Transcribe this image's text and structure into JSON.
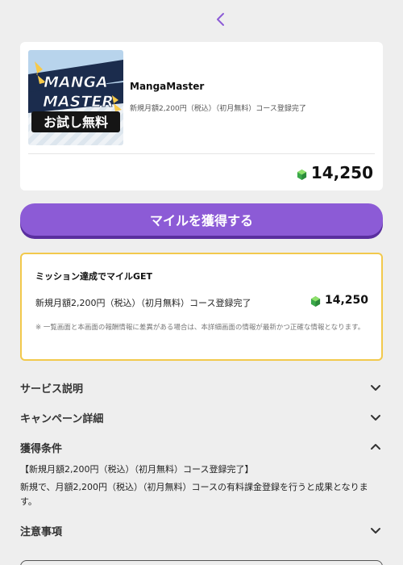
{
  "nav": {
    "back_icon": "chevron-left-icon",
    "accent": "#8c5bd6"
  },
  "offer": {
    "thumbnail_lines": [
      "MANGA",
      "MASTER",
      "お試し無料"
    ],
    "title": "MangaMaster",
    "subtitle": "新規月額2,200円（税込）（初月無料）コース登録完了",
    "points": "14,250",
    "points_icon": "green-gem-icon"
  },
  "cta": {
    "label": "マイルを獲得する",
    "color": "#8c5bd6"
  },
  "mission": {
    "title": "ミッション達成でマイルGET",
    "condition": "新規月額2,200円（税込）（初月無料）コース登録完了",
    "points": "14,250",
    "note": "※ 一覧画面と本画面の報酬情報に差異がある場合は、本詳細画面の情報が最新かつ正確な情報となります。",
    "border_color": "#f2c94c"
  },
  "sections": [
    {
      "label": "サービス説明",
      "expanded": false
    },
    {
      "label": "キャンペーン詳細",
      "expanded": false
    },
    {
      "label": "獲得条件",
      "expanded": true
    },
    {
      "label": "注意事項",
      "expanded": false
    }
  ],
  "conditions": {
    "heading": "【新規月額2,200円（税込）（初月無料）コース登録完了】",
    "body": "新規で、月額2,200円（税込）（初月無料）コースの有料課金登録を行うと成果となります。"
  }
}
